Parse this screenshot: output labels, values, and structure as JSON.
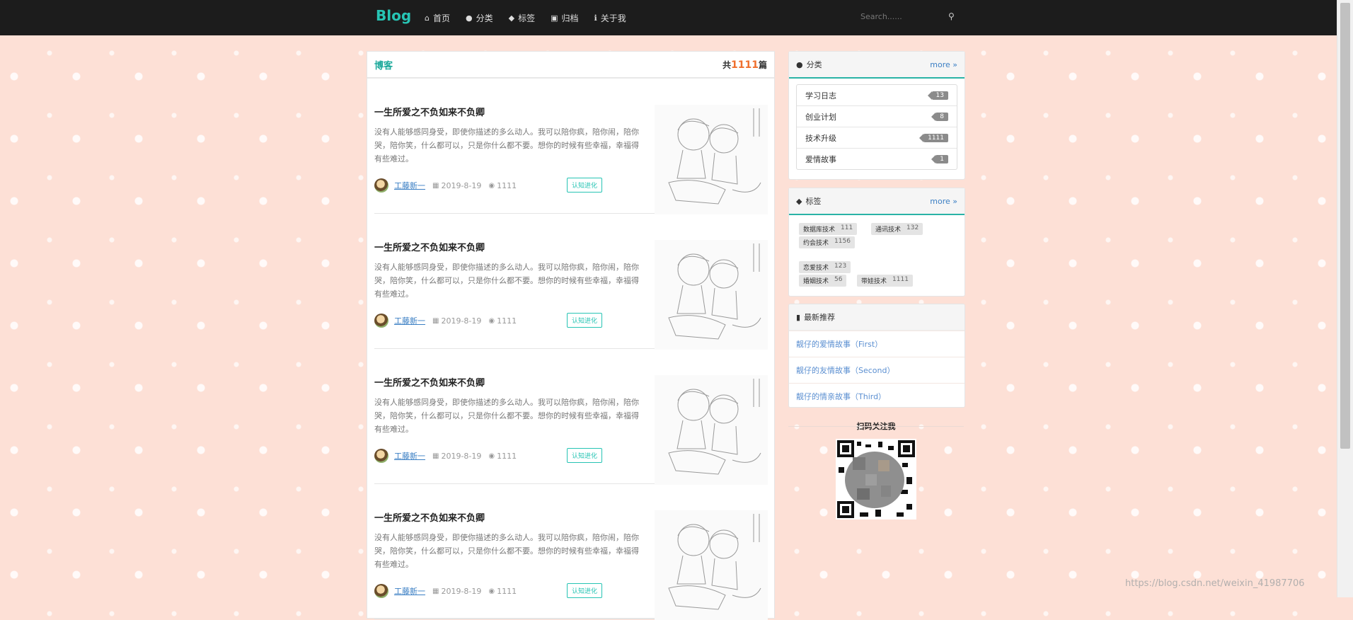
{
  "navbar": {
    "brand": "Blog",
    "items": [
      {
        "label": "首页",
        "icon": "home-icon"
      },
      {
        "label": "分类",
        "icon": "lightbulb-icon"
      },
      {
        "label": "标签",
        "icon": "tags-icon"
      },
      {
        "label": "归档",
        "icon": "clone-icon"
      },
      {
        "label": "关于我",
        "icon": "info-icon"
      }
    ],
    "search_placeholder": "Search......"
  },
  "main": {
    "title": "博客",
    "count_prefix": "共",
    "count": "1111",
    "count_suffix": "篇",
    "posts": [
      {
        "title": "一生所爱之不负如来不负卿",
        "excerpt": "没有人能够感同身受，即使你描述的多么动人。我可以陪你疯，陪你闹，陪你哭，陪你笑，什么都可以，只是你什么都不要。想你的时候有些幸福，幸福得有些难过。",
        "author": "工藤新一",
        "date": "2019-8-19",
        "views": "1111",
        "tag": "认知进化"
      },
      {
        "title": "一生所爱之不负如来不负卿",
        "excerpt": "没有人能够感同身受，即使你描述的多么动人。我可以陪你疯，陪你闹，陪你哭，陪你笑，什么都可以，只是你什么都不要。想你的时候有些幸福，幸福得有些难过。",
        "author": "工藤新一",
        "date": "2019-8-19",
        "views": "1111",
        "tag": "认知进化"
      },
      {
        "title": "一生所爱之不负如来不负卿",
        "excerpt": "没有人能够感同身受，即使你描述的多么动人。我可以陪你疯，陪你闹，陪你哭，陪你笑，什么都可以，只是你什么都不要。想你的时候有些幸福，幸福得有些难过。",
        "author": "工藤新一",
        "date": "2019-8-19",
        "views": "1111",
        "tag": "认知进化"
      },
      {
        "title": "一生所爱之不负如来不负卿",
        "excerpt": "没有人能够感同身受，即使你描述的多么动人。我可以陪你疯，陪你闹，陪你哭，陪你笑，什么都可以，只是你什么都不要。想你的时候有些幸福，幸福得有些难过。",
        "author": "工藤新一",
        "date": "2019-8-19",
        "views": "1111",
        "tag": "认知进化"
      }
    ]
  },
  "sidebar": {
    "categories": {
      "title": "分类",
      "more": "more",
      "items": [
        {
          "name": "学习日志",
          "count": "13"
        },
        {
          "name": "创业计划",
          "count": "8"
        },
        {
          "name": "技术升级",
          "count": "1111"
        },
        {
          "name": "爱情故事",
          "count": "1"
        }
      ]
    },
    "tags": {
      "title": "标签",
      "more": "more",
      "items": [
        {
          "name": "数据库技术",
          "count": "111"
        },
        {
          "name": "通讯技术",
          "count": "132"
        },
        {
          "name": "约会技术",
          "count": "1156"
        },
        {
          "name": "恋爱技术",
          "count": "123"
        },
        {
          "name": "婚姻技术",
          "count": "56"
        },
        {
          "name": "带娃技术",
          "count": "1111"
        }
      ]
    },
    "recommend": {
      "title": "最新推荐",
      "items": [
        "靓仔的爱情故事（First）",
        "靓仔的友情故事（Second）",
        "靓仔的情亲故事（Third）"
      ]
    },
    "qr_title": "扫码关注我"
  },
  "watermark": "https://blog.csdn.net/weixin_41987706",
  "colors": {
    "accent": "#27c4b4",
    "count": "#ef6f2d",
    "link": "#3b7fc4",
    "navbar": "#1c1c1c",
    "page_bg": "#fde0d6"
  }
}
